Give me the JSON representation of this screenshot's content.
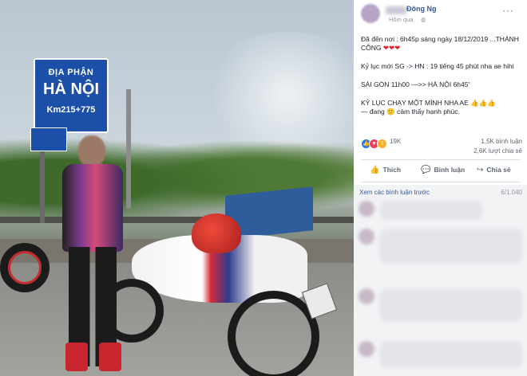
{
  "post": {
    "author": "Đông Ng",
    "time": "Hôm qua",
    "globe_icon": "globe-icon",
    "lines": [
      "Đã đến nơi : 6h45p sáng ngày 18/12/2019 ...THÀNH CÔNG",
      "Kỷ lục mới SG -> HN : 19 tiếng 45 phút nha ae hihi",
      "SÀI GÒN 11h00 —>> HÀ NỘI 6h45'",
      "KỶ LỤC CHẠY MỘT MÌNH NHA AE 👍👍👍",
      "— đang 🙂 cảm thấy hạnh phúc."
    ],
    "hearts": "❤❤❤"
  },
  "photo": {
    "sign_line1": "ĐỊA PHẬN",
    "sign_line2": "HÀ NỘI",
    "sign_line3": "Km215+775"
  },
  "stats": {
    "reaction_count": "19K",
    "comments": "1,5K bình luận",
    "shares": "2,6K lượt chia sẻ"
  },
  "actions": {
    "like": "Thích",
    "comment": "Bình luận",
    "share": "Chia sẻ"
  },
  "comments_section": {
    "view_previous": "Xem các bình luận trước",
    "count": "6/1.040"
  }
}
